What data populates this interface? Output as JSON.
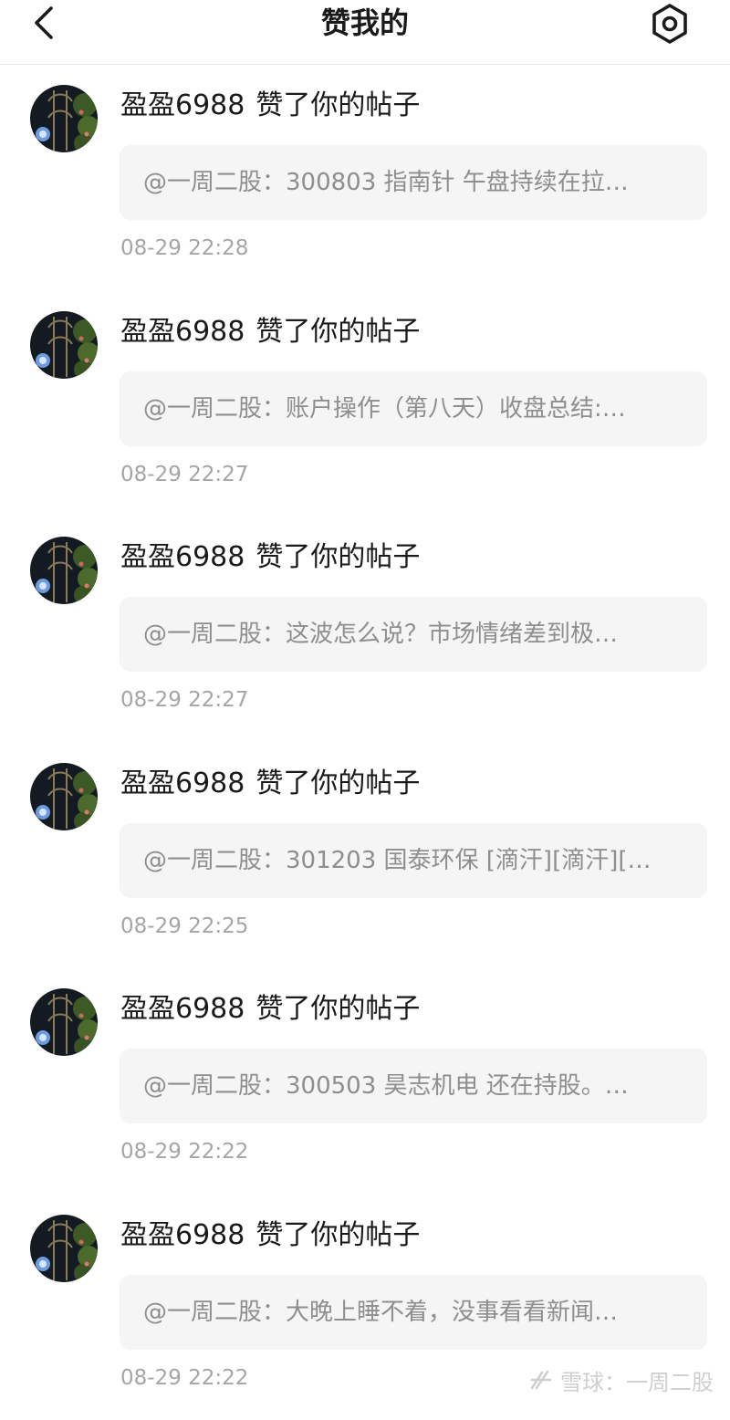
{
  "header": {
    "title": "赞我的",
    "back_icon": "chevron-left-icon",
    "settings_icon": "settings-gear-icon"
  },
  "items": [
    {
      "actor": "盈盈6988",
      "action": "赞了你的帖子",
      "post": "@一周二股：300803 指南针 午盘持续在拉…",
      "time": "08-29 22:28"
    },
    {
      "actor": "盈盈6988",
      "action": "赞了你的帖子",
      "post": "@一周二股：账户操作（第八天）收盘总结:…",
      "time": "08-29 22:27"
    },
    {
      "actor": "盈盈6988",
      "action": "赞了你的帖子",
      "post": "@一周二股：这波怎么说？市场情绪差到极…",
      "time": "08-29 22:27"
    },
    {
      "actor": "盈盈6988",
      "action": "赞了你的帖子",
      "post": "@一周二股：301203 国泰环保 [滴汗][滴汗][…",
      "time": "08-29 22:25"
    },
    {
      "actor": "盈盈6988",
      "action": "赞了你的帖子",
      "post": "@一周二股：300503 昊志机电 还在持股。…",
      "time": "08-29 22:22"
    },
    {
      "actor": "盈盈6988",
      "action": "赞了你的帖子",
      "post": "@一周二股：大晚上睡不着，没事看看新闻…",
      "time": "08-29 22:22"
    }
  ],
  "watermark": {
    "text": "雪球：一周二股",
    "logo_icon": "snowball-logo-icon"
  }
}
